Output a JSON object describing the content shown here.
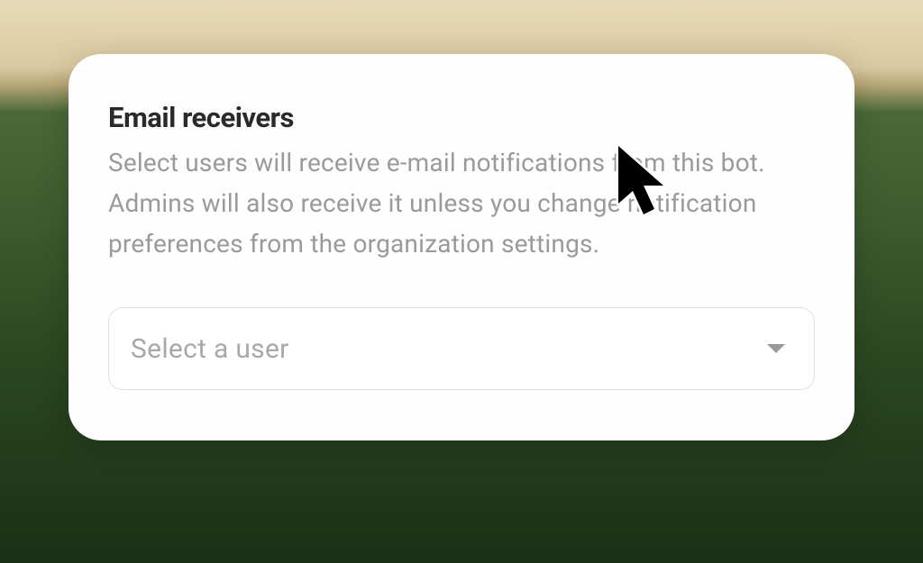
{
  "card": {
    "title": "Email receivers",
    "description": "Select users will receive e-mail notifications from this bot. Admins will also receive it unless you change notification preferences from the organization settings."
  },
  "select": {
    "placeholder": "Select a user"
  }
}
